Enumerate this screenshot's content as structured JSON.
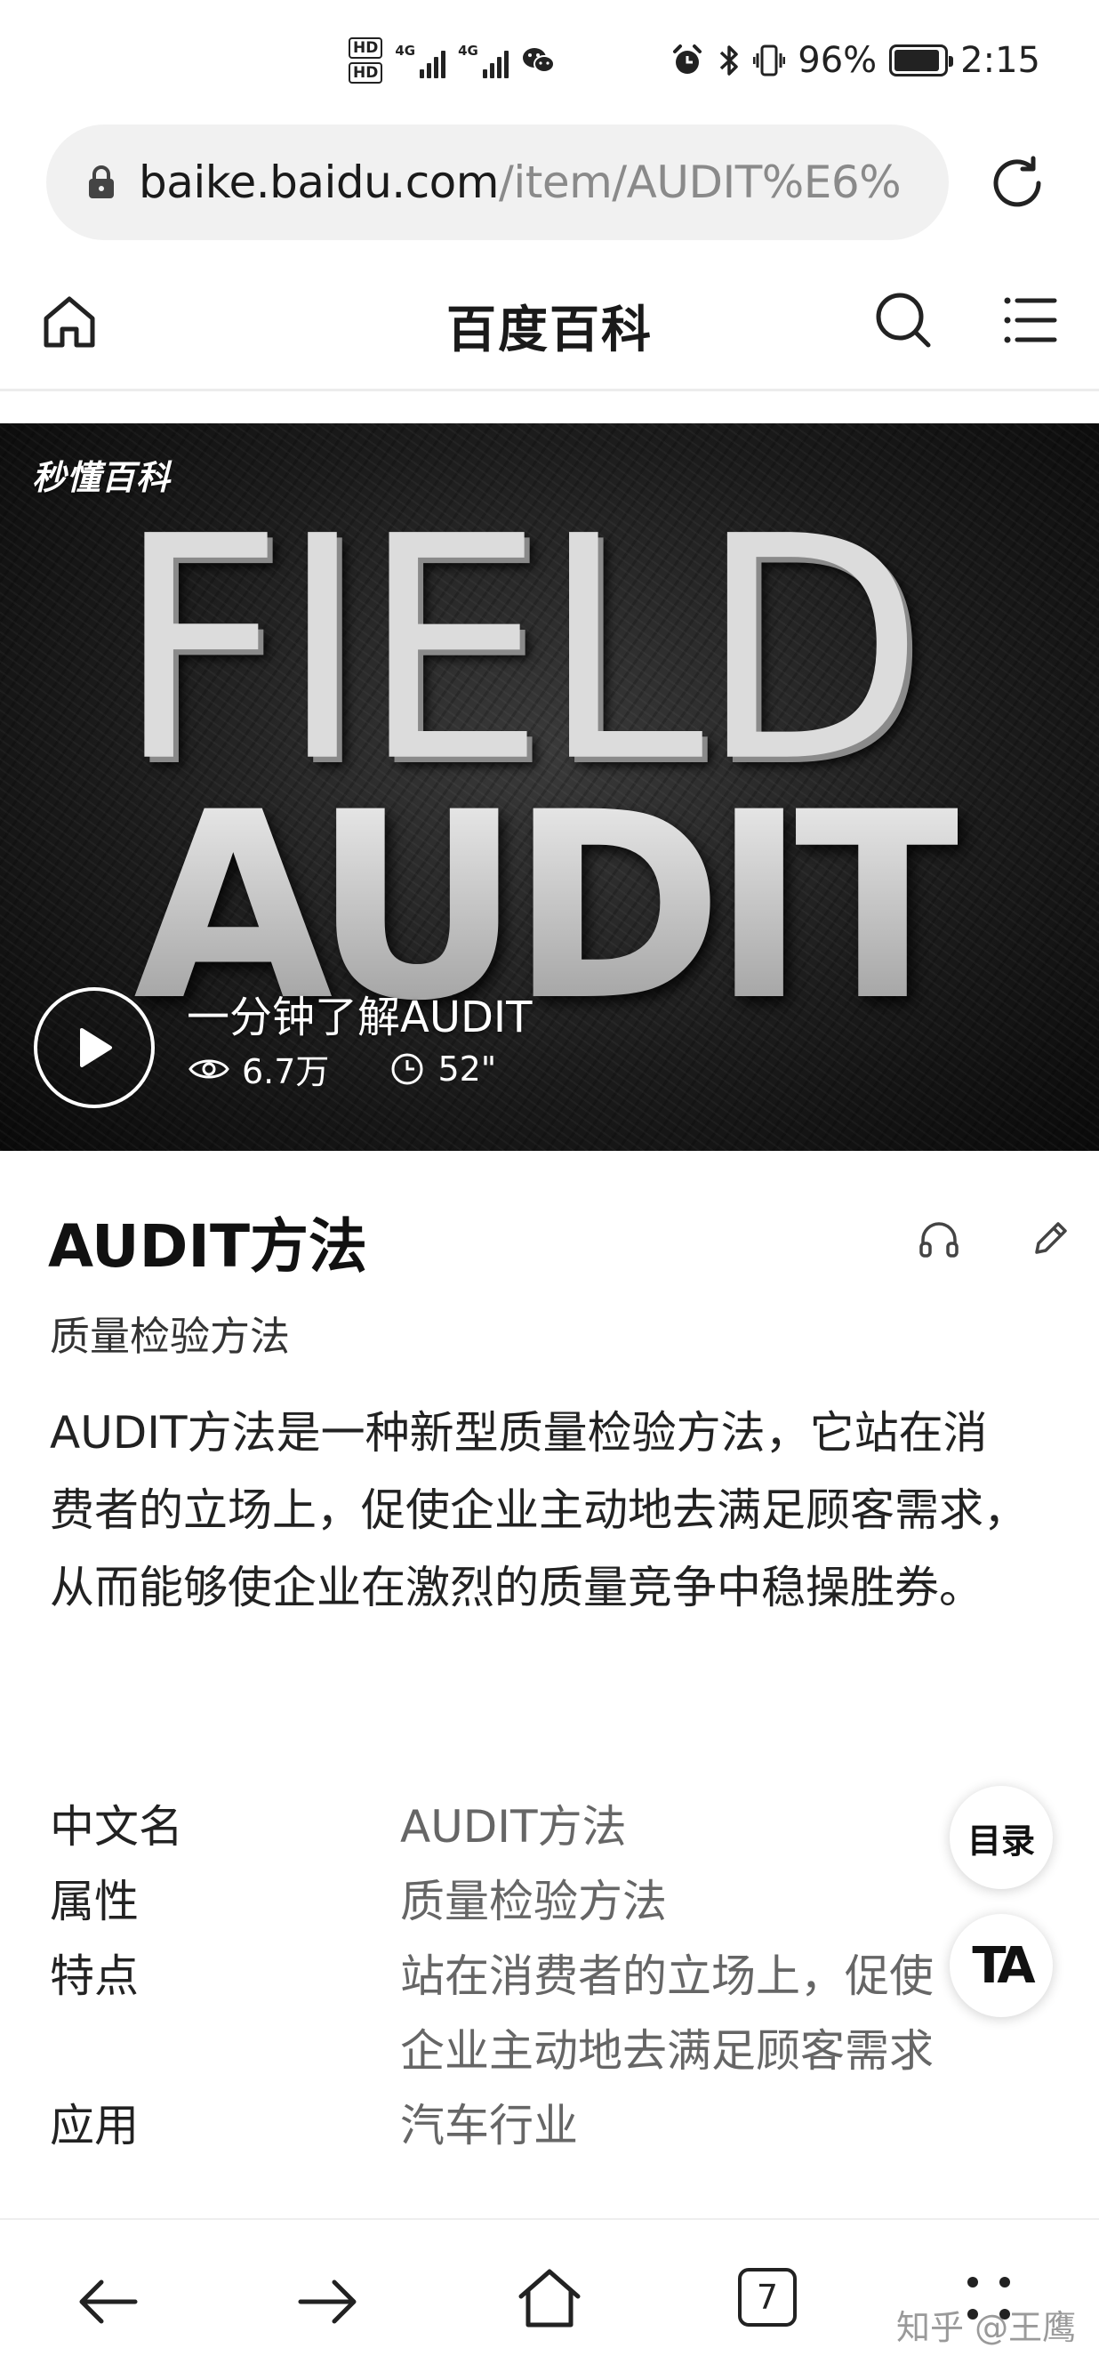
{
  "status_bar": {
    "hd1": "HD",
    "hd2": "HD",
    "sim1_label": "4G",
    "sim2_label": "4G",
    "battery_percent": "96%",
    "time": "2:15",
    "icons": [
      "wechat-icon",
      "alarm-icon",
      "bluetooth-icon",
      "vibrate-icon",
      "battery-icon"
    ]
  },
  "browser": {
    "url_host": "baike.baidu.com",
    "url_path": "/item/AUDIT%E6%",
    "icons": [
      "lock-icon",
      "refresh-icon"
    ]
  },
  "site_header": {
    "title": "百度百科",
    "icons": [
      "home-icon",
      "search-icon",
      "menu-icon"
    ]
  },
  "video": {
    "brand": "秒懂百科",
    "title": "一分钟了解AUDIT",
    "views": "6.7万",
    "duration": "52\"",
    "thumb_line1": "FIELD",
    "thumb_line2": "AUDIT"
  },
  "entry": {
    "title": "AUDIT方法",
    "subtitle": "质量检验方法",
    "summary": "AUDIT方法是一种新型质量检验方法，它站在消费者的立场上，促使企业主动地去满足顾客需求，从而能够使企业在激烈的质量竞争中稳操胜券。"
  },
  "info_box": [
    {
      "key": "中文名",
      "value": "AUDIT方法"
    },
    {
      "key": "属性",
      "value": "质量检验方法"
    },
    {
      "key": "特点",
      "value": "站在消费者的立场上，促使企业主动地去满足顾客需求"
    },
    {
      "key": "应用",
      "value": "汽车行业"
    }
  ],
  "floating": {
    "toc_label": "目录",
    "font_label": "TA"
  },
  "bottom_nav": {
    "tab_count": "7",
    "watermark": "知乎 @王鹰"
  }
}
